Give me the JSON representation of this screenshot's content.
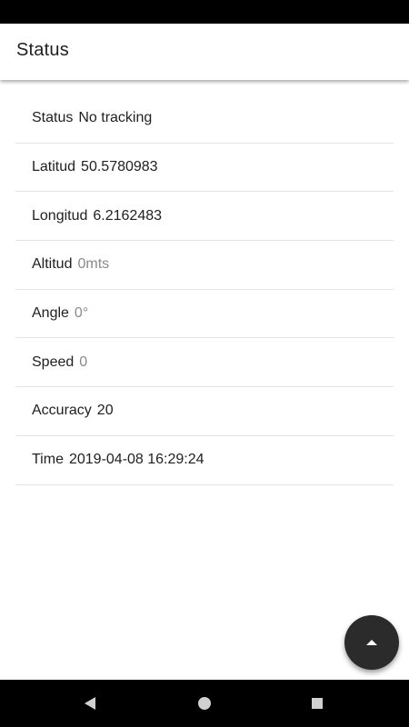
{
  "appbar": {
    "title": "Status"
  },
  "rows": [
    {
      "label": "Status",
      "value": "No tracking",
      "muted": false
    },
    {
      "label": "Latitud",
      "value": "50.5780983",
      "muted": false
    },
    {
      "label": "Longitud",
      "value": "6.2162483",
      "muted": false
    },
    {
      "label": "Altitud",
      "value": "0mts",
      "muted": true
    },
    {
      "label": "Angle",
      "value": "0°",
      "muted": true
    },
    {
      "label": "Speed",
      "value": "0",
      "muted": true
    },
    {
      "label": "Accuracy",
      "value": "20",
      "muted": false
    },
    {
      "label": "Time",
      "value": "2019-04-08 16:29:24",
      "muted": false
    }
  ],
  "fab": {
    "icon": "arrow-up-icon"
  },
  "navbar": {
    "icons": [
      "back-icon",
      "home-icon",
      "recents-icon"
    ]
  },
  "colors": {
    "fab": "#2b2b2b",
    "bars": "#000000",
    "muted_text": "#8a8a8a"
  }
}
